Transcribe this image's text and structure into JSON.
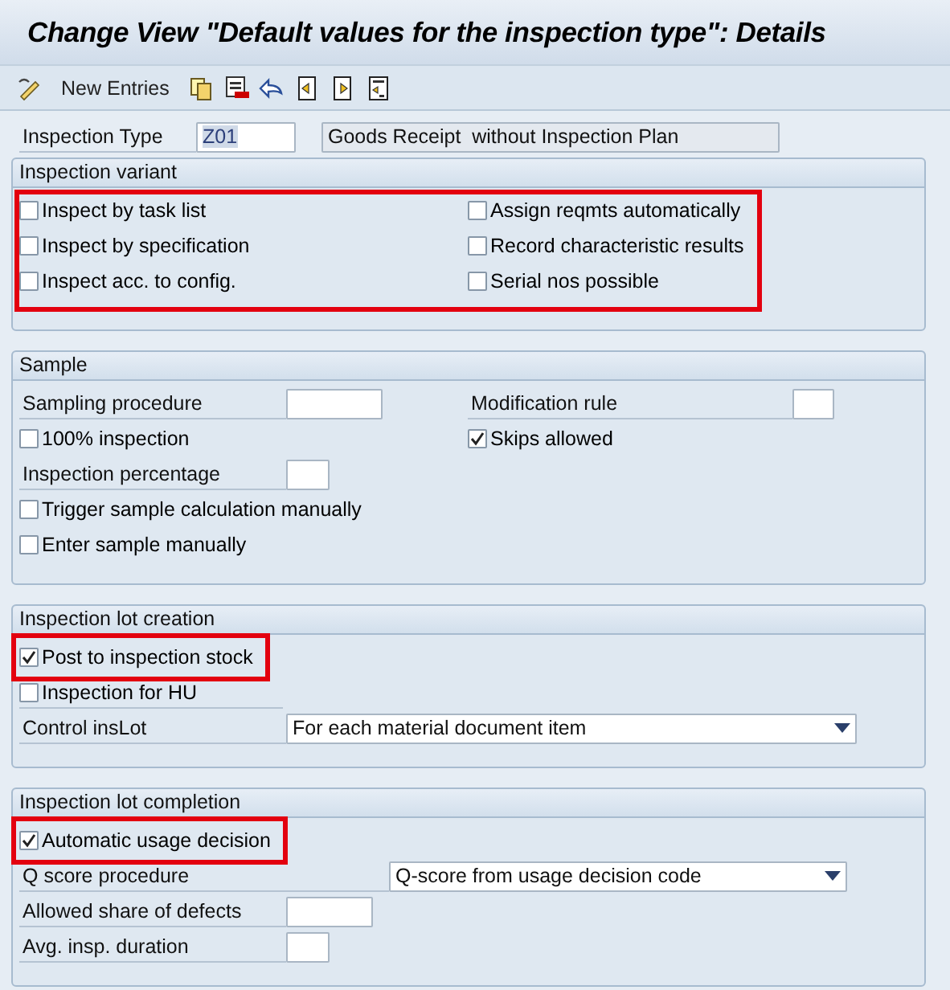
{
  "window": {
    "title": "Change View \"Default values for the inspection type\": Details"
  },
  "toolbar": {
    "new_entries": "New Entries"
  },
  "header": {
    "label": "Inspection Type",
    "value": "Z01",
    "description": "Goods Receipt  without Inspection Plan"
  },
  "sections": [
    {
      "title": "Inspection variant",
      "highlighted": true,
      "rows": [
        [
          {
            "kind": "checkbox",
            "label": "Inspect by task list",
            "checked": false
          },
          {
            "kind": "checkbox",
            "label": "Assign reqmts automatically",
            "checked": false
          }
        ],
        [
          {
            "kind": "checkbox",
            "label": "Inspect by specification",
            "checked": false
          },
          {
            "kind": "checkbox",
            "label": "Record characteristic results",
            "checked": false
          }
        ],
        [
          {
            "kind": "checkbox",
            "label": "Inspect acc. to config.",
            "checked": false
          },
          {
            "kind": "checkbox",
            "label": "Serial nos possible",
            "checked": false
          }
        ]
      ]
    },
    {
      "title": "Sample",
      "rows": [
        [
          {
            "kind": "field",
            "label": "Sampling procedure"
          },
          {
            "kind": "field",
            "label": "Modification rule"
          }
        ],
        [
          {
            "kind": "checkbox",
            "label": "100% inspection",
            "checked": false
          },
          {
            "kind": "checkbox",
            "label": "Skips allowed",
            "checked": true
          }
        ],
        [
          {
            "kind": "field",
            "label": "Inspection percentage"
          }
        ],
        [
          {
            "kind": "checkbox",
            "label": "Trigger sample calculation manually",
            "checked": false
          }
        ],
        [
          {
            "kind": "checkbox",
            "label": "Enter sample manually",
            "checked": false
          }
        ]
      ]
    },
    {
      "title": "Inspection lot creation",
      "rows": [
        [
          {
            "kind": "checkbox",
            "label": "Post to inspection stock",
            "checked": true,
            "highlighted": true
          }
        ],
        [
          {
            "kind": "checkbox",
            "label": "Inspection for HU",
            "checked": false
          }
        ],
        [
          {
            "kind": "dropdown",
            "label": "Control insLot",
            "value": "For each material document item"
          }
        ]
      ]
    },
    {
      "title": "Inspection lot completion",
      "rows": [
        [
          {
            "kind": "checkbox",
            "label": "Automatic usage decision",
            "checked": true,
            "highlighted": true
          }
        ],
        [
          {
            "kind": "dropdown",
            "label": "Q score procedure",
            "value": "Q-score from usage decision code"
          }
        ],
        [
          {
            "kind": "field",
            "label": "Allowed share of defects"
          }
        ],
        [
          {
            "kind": "field",
            "label": "Avg. insp. duration"
          }
        ]
      ]
    }
  ]
}
